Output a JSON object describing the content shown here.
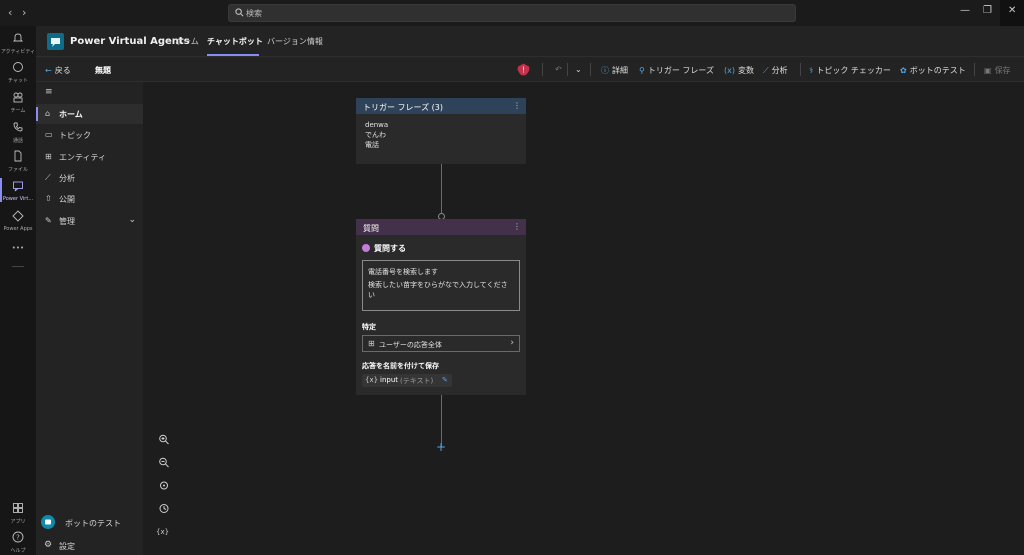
{
  "titlebar": {
    "back": "‹",
    "forward": "›",
    "search_placeholder": "検索",
    "minimize": "—",
    "maximize": "❐",
    "close": "✕"
  },
  "rail": {
    "items": [
      {
        "label": "アクティビティ",
        "icon": "bell-icon"
      },
      {
        "label": "チャット",
        "icon": "chat-icon"
      },
      {
        "label": "チーム",
        "icon": "teams-icon"
      },
      {
        "label": "通話",
        "icon": "phone-icon"
      },
      {
        "label": "ファイル",
        "icon": "file-icon"
      },
      {
        "label": "Power Virt...",
        "icon": "pva-icon"
      },
      {
        "label": "Power Apps",
        "icon": "powerapps-icon"
      },
      {
        "label": "•••",
        "icon": "more-icon"
      }
    ],
    "bottom": [
      {
        "label": "アプリ",
        "icon": "apps-icon"
      },
      {
        "label": "ヘルプ",
        "icon": "help-icon"
      }
    ]
  },
  "header": {
    "app_title": "Power Virtual Agents",
    "tabs": [
      {
        "label": "ホーム"
      },
      {
        "label": "チャットボット"
      },
      {
        "label": "バージョン情報"
      }
    ]
  },
  "toolbar": {
    "back_label": "戻る",
    "topic_name": "無題",
    "details": "詳細",
    "trigger_phrases": "トリガー フレーズ",
    "variables": "変数",
    "analytics": "分析",
    "topic_checker": "トピック チェッカー",
    "test_bot": "ボットのテスト",
    "save": "保存"
  },
  "sidebar": {
    "items": [
      {
        "label": "ホーム"
      },
      {
        "label": "トピック"
      },
      {
        "label": "エンティティ"
      },
      {
        "label": "分析"
      },
      {
        "label": "公開"
      },
      {
        "label": "管理"
      }
    ],
    "test_bot": "ボットのテスト",
    "settings": "設定"
  },
  "canvas": {
    "trigger_node": {
      "title": "トリガー フレーズ (3)",
      "phrases": [
        "denwa",
        "でんわ",
        "電話"
      ]
    },
    "question_node": {
      "header": "質問",
      "title": "質問する",
      "message_lines": [
        "電話番号を検索します",
        "検索したい苗字をひらがなで入力してください"
      ],
      "identify_label": "特定",
      "identify_value": "ユーザーの応答全体",
      "save_label": "応答を名前を付けて保存",
      "var_prefix": "{x}",
      "var_name": "input",
      "var_type": "(テキスト)"
    },
    "zoom_controls": [
      "zoom-in-icon",
      "zoom-out-icon",
      "recenter-icon",
      "history-icon",
      "variables-icon"
    ]
  },
  "colors": {
    "accent": "#8b8cf0",
    "trigger_header": "#2e4259",
    "question_header": "#43304a",
    "blue_icon": "#52a8e6",
    "question_circle": "#c77ad8"
  }
}
